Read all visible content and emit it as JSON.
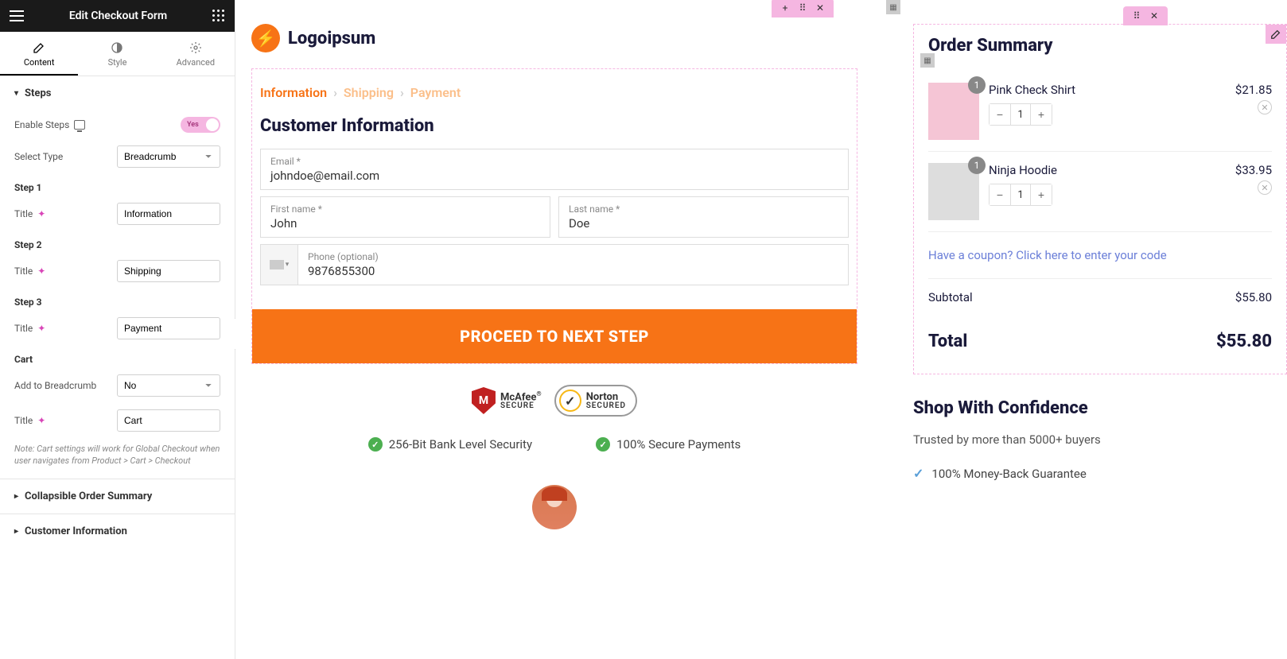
{
  "header": {
    "title": "Edit Checkout Form"
  },
  "tabs": {
    "content": "Content",
    "style": "Style",
    "advanced": "Advanced"
  },
  "sections": {
    "steps": {
      "title": "Steps",
      "enable_label": "Enable Steps",
      "enable_value": "Yes",
      "select_type_label": "Select Type",
      "select_type_value": "Breadcrumb",
      "step1_label": "Step 1",
      "step2_label": "Step 2",
      "step3_label": "Step 3",
      "title_label": "Title",
      "step1_value": "Information",
      "step2_value": "Shipping",
      "step3_value": "Payment",
      "cart_label": "Cart",
      "add_breadcrumb_label": "Add to Breadcrumb",
      "add_breadcrumb_value": "No",
      "cart_title_value": "Cart",
      "note": "Note: Cart settings will work for Global Checkout when user navigates from Product > Cart > Checkout"
    },
    "collapsible": "Collapsible Order Summary",
    "customer_info": "Customer Information"
  },
  "brand": {
    "name": "Logoipsum"
  },
  "breadcrumb": {
    "s1": "Information",
    "s2": "Shipping",
    "s3": "Payment"
  },
  "form": {
    "title": "Customer Information",
    "email_label": "Email *",
    "email_value": "johndoe@email.com",
    "fname_label": "First name *",
    "fname_value": "John",
    "lname_label": "Last name *",
    "lname_value": "Doe",
    "phone_label": "Phone (optional)",
    "phone_value": "9876855300",
    "proceed": "PROCEED TO NEXT STEP"
  },
  "badges": {
    "mcafee": "McAfee",
    "mcafee_sub": "SECURE",
    "norton": "Norton",
    "norton_sub": "SECURED"
  },
  "trust": {
    "t1": "256-Bit Bank Level Security",
    "t2": "100% Secure Payments"
  },
  "order": {
    "title": "Order Summary",
    "items": [
      {
        "name": "Pink Check Shirt",
        "price": "$21.85",
        "qty": "1"
      },
      {
        "name": "Ninja Hoodie",
        "price": "$33.95",
        "qty": "1"
      }
    ],
    "coupon": "Have a coupon? Click here to enter your code",
    "subtotal_label": "Subtotal",
    "subtotal": "$55.80",
    "total_label": "Total",
    "total": "$55.80"
  },
  "confidence": {
    "title": "Shop With Confidence",
    "sub": "Trusted by more than 5000+ buyers",
    "g1": "100% Money-Back Guarantee"
  }
}
